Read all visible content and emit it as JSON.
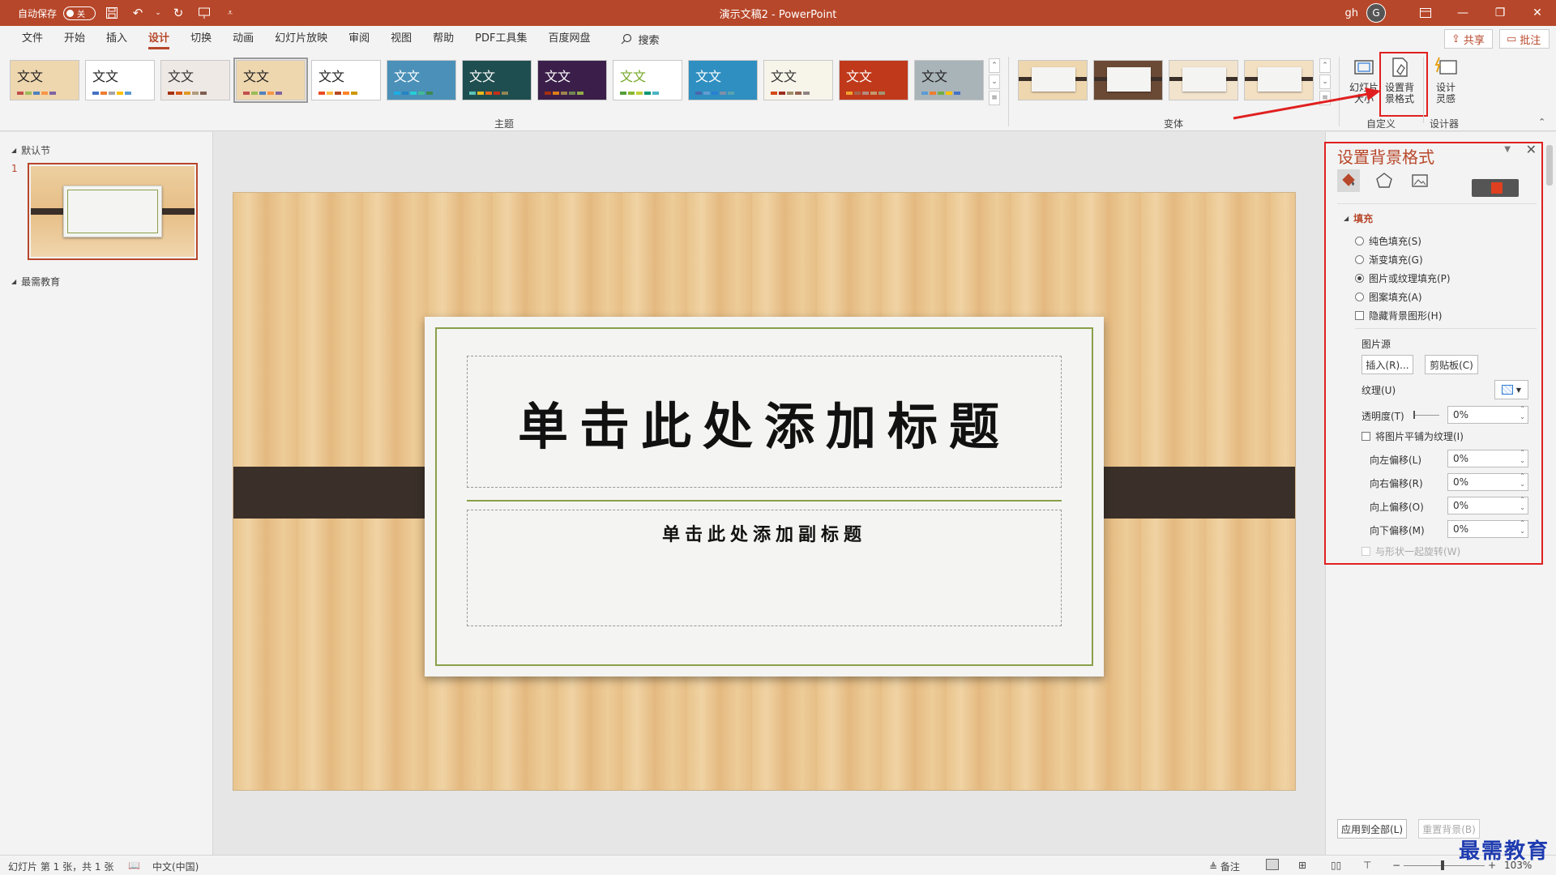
{
  "titlebar": {
    "autosave_label": "自动保存",
    "autosave_state": "关",
    "doc_title": "演示文稿2  -  PowerPoint",
    "user_initials": "gh",
    "avatar_letter": "G"
  },
  "menu": {
    "tabs": [
      "文件",
      "开始",
      "插入",
      "设计",
      "切换",
      "动画",
      "幻灯片放映",
      "审阅",
      "视图",
      "帮助",
      "PDF工具集",
      "百度网盘"
    ],
    "active_tab": "设计",
    "search_label": "搜索",
    "share_label": "共享",
    "comment_label": "批注"
  },
  "ribbon": {
    "themes_group_label": "主题",
    "variants_group_label": "变体",
    "customize_group_label": "自定义",
    "designer_group_label": "设计器",
    "theme_sample_text": "文文",
    "slide_size_label": "幻灯片\n大小",
    "format_bg_label": "设置背\n景格式",
    "design_ideas_label": "设计\n灵感",
    "themes": [
      {
        "bg": "#eed6ae",
        "fg": "#222",
        "text": "文文",
        "stripes": [
          "#c0504d",
          "#9bbb59",
          "#4f81bd",
          "#f79646",
          "#8064a2"
        ]
      },
      {
        "bg": "#ffffff",
        "fg": "#222",
        "text": "文文",
        "stripes": [
          "#4472c4",
          "#ed7d31",
          "#a5a5a5",
          "#ffc000",
          "#5b9bd5"
        ]
      },
      {
        "bg": "#efe9e5",
        "fg": "#333",
        "text": "文文",
        "stripes": [
          "#a5300f",
          "#d55816",
          "#e19825",
          "#b19c7d",
          "#7f5f52"
        ]
      },
      {
        "bg": "#eed6ae",
        "fg": "#222",
        "text": "文文",
        "stripes": [
          "#c0504d",
          "#9bbb59",
          "#4f81bd",
          "#f79646",
          "#8064a2"
        ]
      },
      {
        "bg": "#ffffff",
        "fg": "#222",
        "text": "文文",
        "stripes": [
          "#e84c22",
          "#ffbd47",
          "#b64926",
          "#ff8427",
          "#cc9900"
        ]
      },
      {
        "bg": "#4a90b8",
        "fg": "#fff",
        "text": "文文",
        "stripes": [
          "#1cade4",
          "#2683c6",
          "#27ced7",
          "#42ba97",
          "#3e8853"
        ]
      },
      {
        "bg": "#1f4e50",
        "fg": "#fff",
        "text": "文文",
        "stripes": [
          "#5cc2b8",
          "#e6b91e",
          "#e76618",
          "#c42f1a",
          "#918655"
        ]
      },
      {
        "bg": "#3b1f4a",
        "fg": "#fff",
        "text": "文文",
        "stripes": [
          "#a53010",
          "#de7e18",
          "#9f8351",
          "#728653",
          "#92aa4c"
        ]
      },
      {
        "bg": "#ffffff",
        "fg": "#76a828",
        "text": "文文",
        "stripes": [
          "#549e39",
          "#8ab833",
          "#c0cf3a",
          "#029676",
          "#4ab5c4"
        ]
      },
      {
        "bg": "#2f8fc0",
        "fg": "#fff",
        "text": "文文",
        "stripes": [
          "#4a66ac",
          "#629dd1",
          "#297fd5",
          "#7f8fa9",
          "#5aa2ae"
        ]
      },
      {
        "bg": "#f7f4ea",
        "fg": "#333",
        "text": "文文",
        "stripes": [
          "#d34817",
          "#9b2d1f",
          "#a28e6a",
          "#956251",
          "#918485"
        ]
      },
      {
        "bg": "#c0391b",
        "fg": "#fff",
        "text": "文文",
        "stripes": [
          "#f0a22e",
          "#a5644e",
          "#b58b80",
          "#c3986d",
          "#a19574"
        ]
      },
      {
        "bg": "#a9b4b9",
        "fg": "#222",
        "text": "文文",
        "stripes": [
          "#5b9bd5",
          "#ed7d31",
          "#70ad47",
          "#ffc000",
          "#4472c4"
        ]
      }
    ],
    "variants": [
      {
        "bg": "#eed6ae"
      },
      {
        "bg": "#6b4a35"
      },
      {
        "bg": "#f2e3cc"
      },
      {
        "bg": "#f3dfc2"
      }
    ]
  },
  "thumbpane": {
    "section1": "默认节",
    "slide_number": "1",
    "section2": "最需教育"
  },
  "slide": {
    "title_placeholder": "单击此处添加标题",
    "subtitle_placeholder": "单击此处添加副标题"
  },
  "format_pane": {
    "title": "设置背景格式",
    "fill_section": "填充",
    "solid_fill": "纯色填充(S)",
    "gradient_fill": "渐变填充(G)",
    "picture_fill": "图片或纹理填充(P)",
    "pattern_fill": "图案填充(A)",
    "hide_bg_graphics": "隐藏背景图形(H)",
    "picture_source": "图片源",
    "insert_btn": "插入(R)...",
    "clipboard_btn": "剪贴板(C)",
    "texture_label": "纹理(U)",
    "transparency_label": "透明度(T)",
    "transparency_value": "0%",
    "tile_label": "将图片平铺为纹理(I)",
    "offset_left_label": "向左偏移(L)",
    "offset_left_value": "0%",
    "offset_right_label": "向右偏移(R)",
    "offset_right_value": "0%",
    "offset_top_label": "向上偏移(O)",
    "offset_top_value": "0%",
    "offset_bottom_label": "向下偏移(M)",
    "offset_bottom_value": "0%",
    "rotate_with_shape": "与形状一起旋转(W)",
    "apply_all_btn": "应用到全部(L)",
    "reset_bg_btn": "重置背景(B)"
  },
  "statusbar": {
    "slide_info": "幻灯片 第 1 张，共 1 张",
    "language": "中文(中国)",
    "notes_label": "备注",
    "zoom": "103%"
  },
  "watermark": "最需教育",
  "colors": {
    "accent": "#b7472a",
    "highlight_red": "#e02020"
  }
}
